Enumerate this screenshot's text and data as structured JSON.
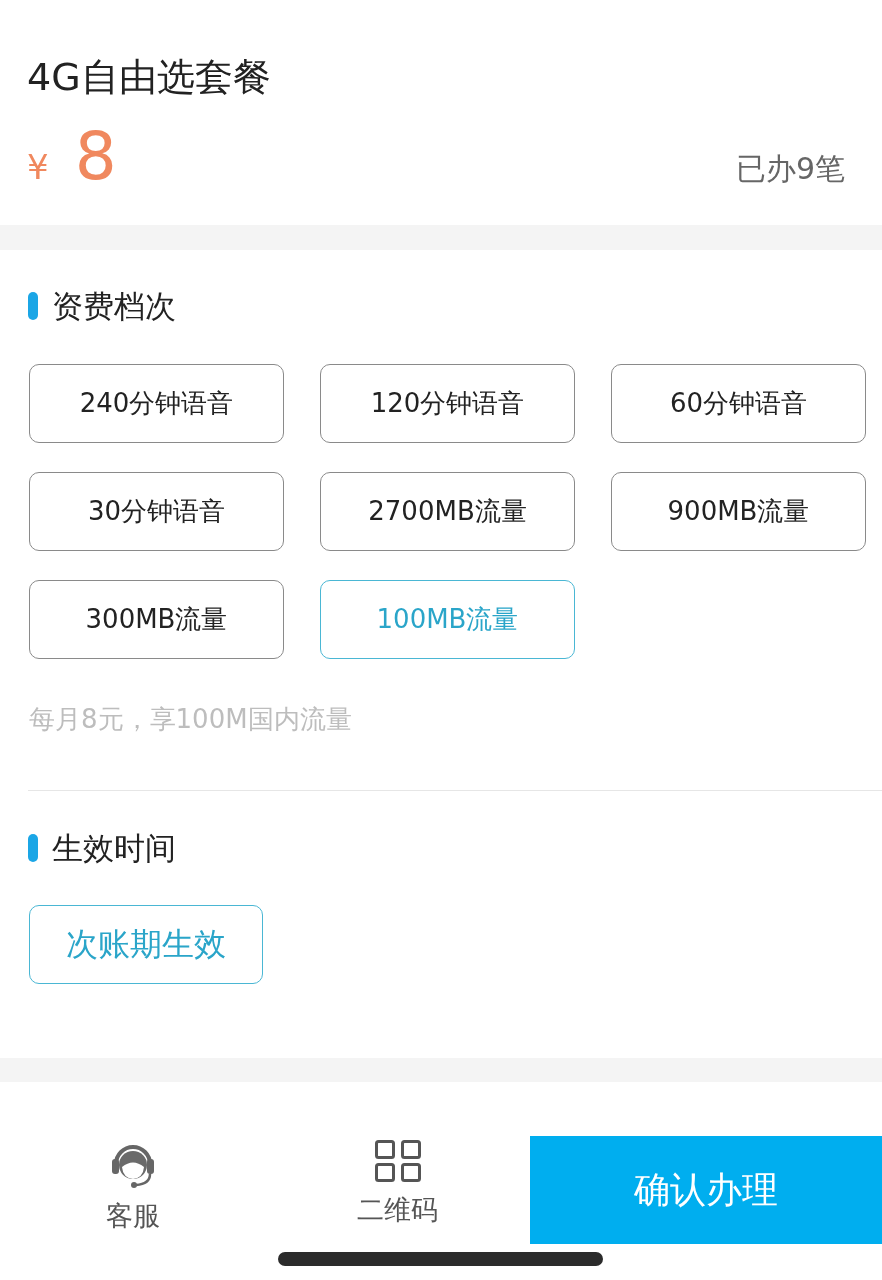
{
  "product": {
    "title": "4G自由选套餐",
    "currency": "¥",
    "price": "8",
    "orders": "已办9笔"
  },
  "tariff": {
    "heading": "资费档次",
    "options": [
      {
        "label": "240分钟语音",
        "selected": false
      },
      {
        "label": "120分钟语音",
        "selected": false
      },
      {
        "label": "60分钟语音",
        "selected": false
      },
      {
        "label": "30分钟语音",
        "selected": false
      },
      {
        "label": "2700MB流量",
        "selected": false
      },
      {
        "label": "900MB流量",
        "selected": false
      },
      {
        "label": "300MB流量",
        "selected": false
      },
      {
        "label": "100MB流量",
        "selected": true
      }
    ],
    "description": "每月8元，享100M国内流量"
  },
  "effective_time": {
    "heading": "生效时间",
    "options": [
      {
        "label": "次账期生效",
        "selected": true
      }
    ]
  },
  "bottom_bar": {
    "items": [
      {
        "kind": "support",
        "label": "客服"
      },
      {
        "kind": "qrcode",
        "label": "二维码"
      }
    ],
    "confirm_button": {
      "label": "确认办理"
    }
  }
}
